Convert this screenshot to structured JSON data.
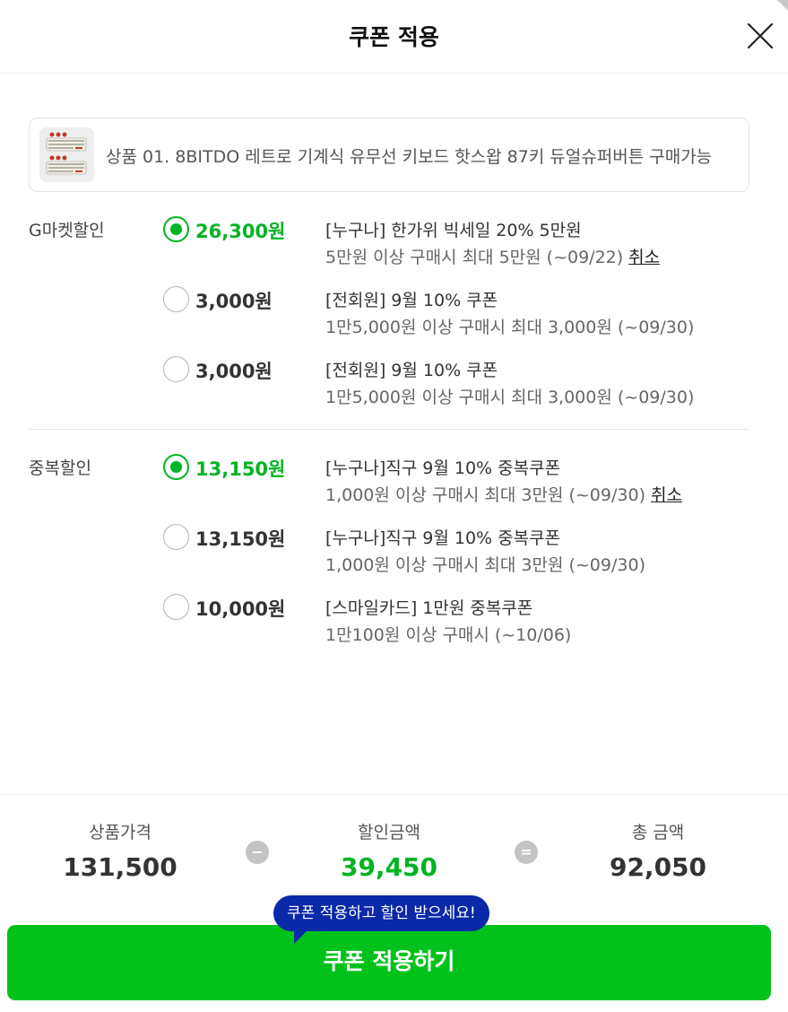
{
  "header": {
    "title": "쿠폰 적용"
  },
  "product": {
    "name": "상품 01. 8BITDO 레트로 기계식 유무선 키보드 핫스왑 87키 듀얼슈퍼버튼 구매가능"
  },
  "gmarket_discount": {
    "label": "G마켓할인",
    "options": [
      {
        "amount": "26,300원",
        "selected": true,
        "title": "[누구나] 한가위 빅세일 20% 5만원",
        "desc": "5만원 이상 구매시 최대 5만원 (~09/22)",
        "cancel": "취소"
      },
      {
        "amount": "3,000원",
        "selected": false,
        "title": "[전회원] 9월 10% 쿠폰",
        "desc": "1만5,000원 이상 구매시 최대 3,000원 (~09/30)"
      },
      {
        "amount": "3,000원",
        "selected": false,
        "title": "[전회원] 9월 10% 쿠폰",
        "desc": "1만5,000원 이상 구매시 최대 3,000원 (~09/30)"
      }
    ]
  },
  "duplicate_discount": {
    "label": "중복할인",
    "options": [
      {
        "amount": "13,150원",
        "selected": true,
        "title": "[누구나]직구 9월 10% 중복쿠폰",
        "desc": "1,000원 이상 구매시 최대 3만원 (~09/30)",
        "cancel": "취소"
      },
      {
        "amount": "13,150원",
        "selected": false,
        "title": "[누구나]직구 9월 10% 중복쿠폰",
        "desc": "1,000원 이상 구매시 최대 3만원 (~09/30)"
      },
      {
        "amount": "10,000원",
        "selected": false,
        "title": "[스마일카드] 1만원 중복쿠폰",
        "desc": "1만100원 이상 구매시 (~10/06)"
      }
    ]
  },
  "summary": {
    "price_label": "상품가격",
    "price_value": "131,500",
    "minus_symbol": "−",
    "discount_label": "할인금액",
    "discount_value": "39,450",
    "equals_symbol": "=",
    "total_label": "총 금액",
    "total_value": "92,050"
  },
  "tooltip": {
    "text": "쿠폰 적용하고 할인 받으세요!"
  },
  "apply_button": {
    "label": "쿠폰 적용하기"
  },
  "colors": {
    "accent_green": "#00b422",
    "button_green": "#00c21b",
    "tooltip_blue": "#0b28a8"
  },
  "icons": {
    "close": "close-icon",
    "radio_checked": "radio-checked-icon",
    "radio_unchecked": "radio-unchecked-icon",
    "minus": "minus-icon",
    "equals": "equals-icon"
  }
}
